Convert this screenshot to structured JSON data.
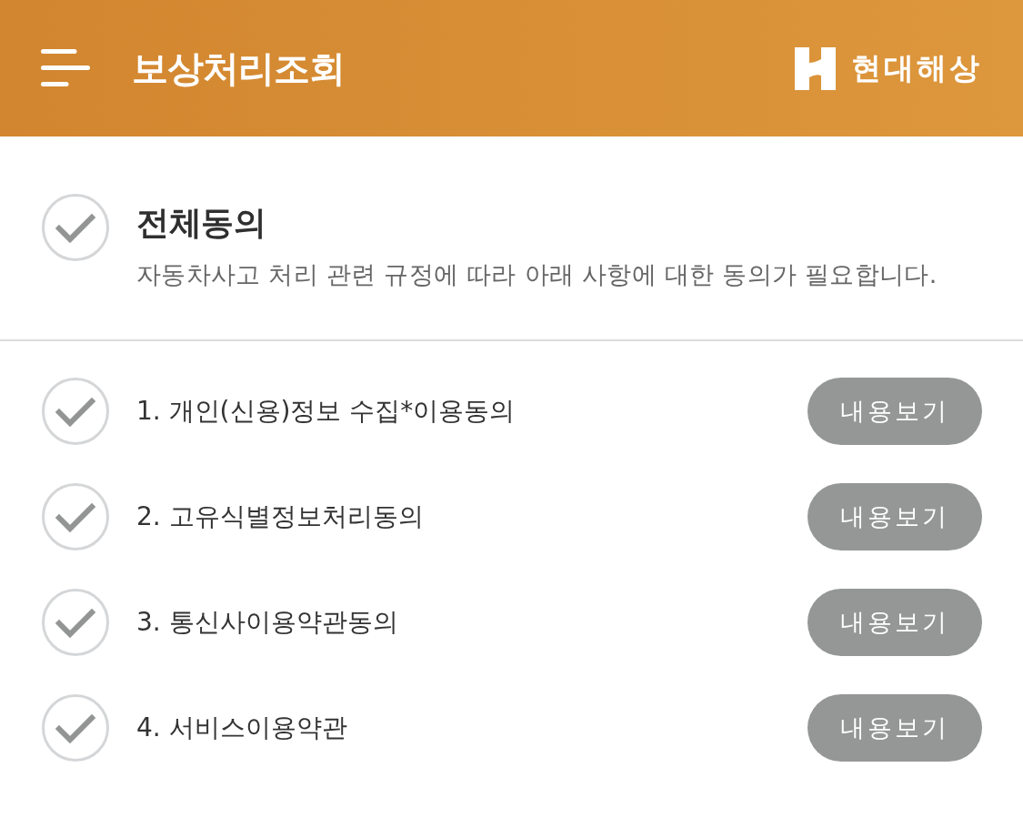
{
  "header": {
    "title": "보상처리조회",
    "brand": "현대해상"
  },
  "agree_all": {
    "title": "전체동의",
    "description": "자동차사고 처리 관련 규정에 따라 아래 사항에 대한 동의가 필요합니다.",
    "checked": false
  },
  "items": [
    {
      "label": "1. 개인(신용)정보 수집*이용동의",
      "checked": false,
      "button": "내용보기"
    },
    {
      "label": "2. 고유식별정보처리동의",
      "checked": false,
      "button": "내용보기"
    },
    {
      "label": "3. 통신사이용약관동의",
      "checked": false,
      "button": "내용보기"
    },
    {
      "label": "4. 서비스이용약관",
      "checked": false,
      "button": "내용보기"
    }
  ]
}
